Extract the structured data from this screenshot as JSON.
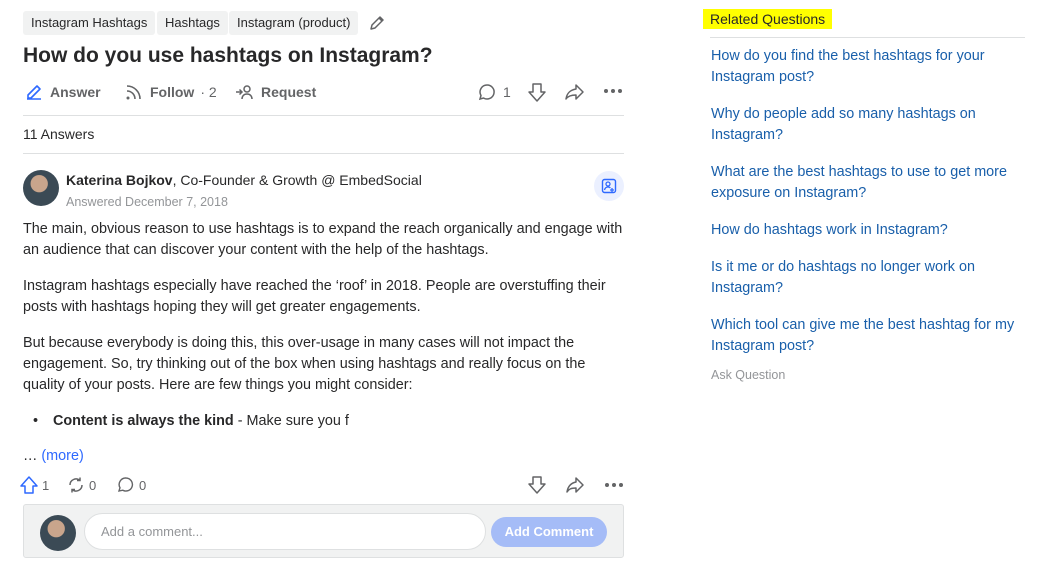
{
  "tags": [
    "Instagram Hashtags",
    "Hashtags",
    "Instagram (product)"
  ],
  "question": {
    "title": "How do you use hashtags on Instagram?",
    "actions": {
      "answer_label": "Answer",
      "follow_label": "Follow",
      "follow_count": "· 2",
      "request_label": "Request",
      "comment_count": "1"
    },
    "icons": [
      "pencil-icon",
      "answer-edit-icon",
      "follow-rss-icon",
      "request-icon",
      "comment-icon",
      "downvote-icon",
      "share-icon",
      "more-icon"
    ]
  },
  "answers_count_label": "11 Answers",
  "answer": {
    "author_name": "Katerina Bojkov",
    "author_credential": ", Co-Founder & Growth @ EmbedSocial",
    "date": "Answered December 7, 2018",
    "paragraphs": [
      "The main, obvious reason to use hashtags is to expand the reach organically and engage with an audience that can discover your content with the help of the hashtags.",
      "Instagram hashtags especially have reached the ‘roof’ in 2018. People are overstuffing their posts with hashtags hoping they will get greater engagements.",
      "But because everybody is doing this, this over-usage in many cases will not impact the engagement. So, try thinking out of the box when using hashtags and really focus on the quality of your posts. Here are few things you might consider:"
    ],
    "bullet_bold": "Content is always the kind",
    "bullet_text": " - Make sure you f",
    "ellipsis": "… ",
    "more_label": "(more)",
    "upvotes": "1",
    "shares": "0",
    "comments": "0"
  },
  "comment": {
    "placeholder": "Add a comment...",
    "button_label": "Add Comment"
  },
  "related": {
    "title": "Related Questions",
    "questions": [
      "How do you find the best hashtags for your Instagram post?",
      "Why do people add so many hashtags on Instagram?",
      "What are the best hashtags to use to get more exposure on Instagram?",
      "How do hashtags work in Instagram?",
      "Is it me or do hashtags no longer work on Instagram?",
      "Which tool can give me the best hashtag for my Instagram post?"
    ],
    "ask_label": "Ask Question"
  },
  "colors": {
    "link": "#195faa",
    "accent": "#2e69ff",
    "highlight": "#ffff00",
    "button_disabled": "#a5bcf7"
  }
}
